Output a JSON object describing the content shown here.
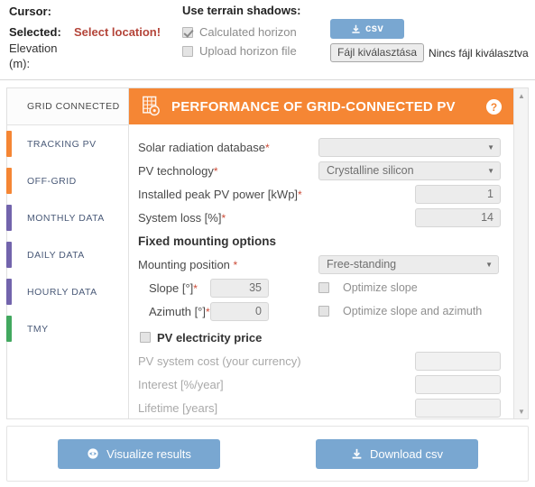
{
  "top": {
    "cursor_label": "Cursor:",
    "selected_label": "Selected:",
    "select_location_text": "Select location!",
    "elevation_line1": "Elevation",
    "elevation_line2": "(m):",
    "terrain_shadows_title": "Use terrain shadows:",
    "calculated_horizon_label": "Calculated horizon",
    "calculated_horizon_checked": true,
    "upload_horizon_label": "Upload horizon file",
    "upload_horizon_checked": false,
    "csv_button_label": "csv",
    "file_choose_label": "Fájl kiválasztása",
    "file_status_text": "Nincs fájl kiválasztva"
  },
  "tabs": [
    {
      "label": "GRID CONNECTED",
      "accent": "",
      "active": true
    },
    {
      "label": "TRACKING PV",
      "accent": "#f58634",
      "active": false
    },
    {
      "label": "OFF-GRID",
      "accent": "#f58634",
      "active": false
    },
    {
      "label": "MONTHLY DATA",
      "accent": "#7264ac",
      "active": false
    },
    {
      "label": "DAILY DATA",
      "accent": "#7264ac",
      "active": false
    },
    {
      "label": "HOURLY DATA",
      "accent": "#7264ac",
      "active": false
    },
    {
      "label": "TMY",
      "accent": "#42a85f",
      "active": false
    }
  ],
  "header": {
    "title": "PERFORMANCE OF GRID-CONNECTED PV",
    "background_color": "#f58634",
    "icon": "grid-gear-icon",
    "help_icon": "help-circle-icon"
  },
  "form": {
    "solar_db_label": "Solar radiation database",
    "solar_db_value": "",
    "pv_tech_label": "PV technology",
    "pv_tech_value": "Crystalline silicon",
    "peak_power_label": "Installed peak PV power [kWp]",
    "peak_power_value": "1",
    "system_loss_label": "System loss [%]",
    "system_loss_value": "14",
    "fixed_mounting_title": "Fixed mounting options",
    "mounting_position_label": "Mounting position",
    "mounting_position_value": "Free-standing",
    "slope_label": "Slope [°]",
    "slope_value": "35",
    "azimuth_label": "Azimuth [°]",
    "azimuth_value": "0",
    "optimize_slope_label": "Optimize slope",
    "optimize_slope_checked": false,
    "optimize_slope_azimuth_label": "Optimize slope and azimuth",
    "optimize_slope_azimuth_checked": false,
    "pv_price_label": "PV electricity price",
    "pv_price_checked": false,
    "system_cost_label": "PV system cost (your currency)",
    "system_cost_value": "",
    "interest_label": "Interest [%/year]",
    "interest_value": "",
    "lifetime_label": "Lifetime [years]",
    "lifetime_value": "",
    "required_marker": "*"
  },
  "bottom": {
    "visualize_label": "Visualize results",
    "visualize_icon": "eye-icon",
    "download_label": "Download csv",
    "download_icon": "download-icon",
    "button_color": "#79a7d1"
  }
}
